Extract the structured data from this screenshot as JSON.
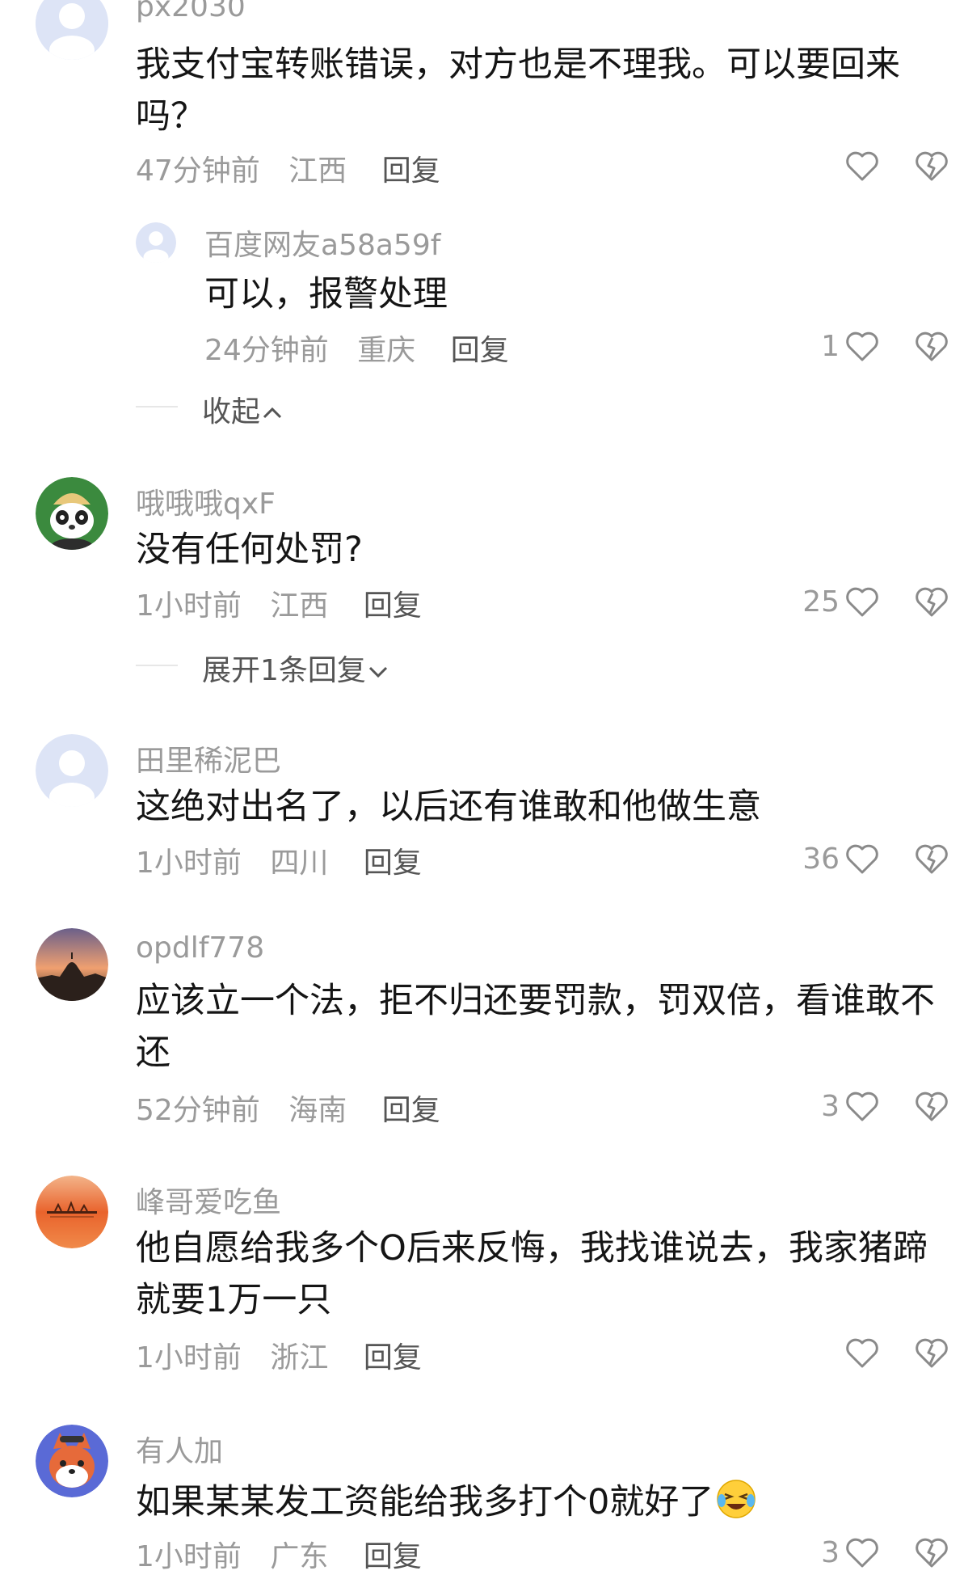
{
  "comments": [
    {
      "username": "px2030",
      "text": "我支付宝转账错误，对方也是不理我。可以要回来吗？",
      "time": "47分钟前",
      "location": "江西",
      "reply_label": "回复",
      "likes": "",
      "avatar": "default-avatar"
    },
    {
      "username": "百度网友a58a59f",
      "text": "可以，报警处理",
      "time": "24分钟前",
      "location": "重庆",
      "reply_label": "回复",
      "likes": "1",
      "avatar": "default-avatar"
    },
    {
      "username": "哦哦哦qxF",
      "text": "没有任何处罚?",
      "time": "1小时前",
      "location": "江西",
      "reply_label": "回复",
      "likes": "25",
      "avatar": "panda-avatar"
    },
    {
      "username": "田里稀泥巴",
      "text": "这绝对出名了，以后还有谁敢和他做生意",
      "time": "1小时前",
      "location": "四川",
      "reply_label": "回复",
      "likes": "36",
      "avatar": "default-avatar"
    },
    {
      "username": "opdlf778",
      "text": "应该立一个法，拒不归还要罚款，罚双倍，看谁敢不还",
      "time": "52分钟前",
      "location": "海南",
      "reply_label": "回复",
      "likes": "3",
      "avatar": "sunset-city-avatar"
    },
    {
      "username": "峰哥爱吃鱼",
      "text": "他自愿给我多个O后来反悔，我找谁说去，我家猪蹄就要1万一只",
      "time": "1小时前",
      "location": "浙江",
      "reply_label": "回复",
      "likes": "",
      "avatar": "sunset-lake-avatar"
    },
    {
      "username": "有人加",
      "text": "如果某某发工资能给我多打个0就好了",
      "time": "1小时前",
      "location": "广东",
      "reply_label": "回复",
      "likes": "3",
      "avatar": "fox-avatar"
    }
  ],
  "collapse_label": "收起",
  "expand_label": "展开1条回复",
  "icons": {
    "like": "heart-outline-icon",
    "dislike": "broken-heart-icon",
    "emoji": "laughing-crying-emoji-icon"
  },
  "colors": {
    "meta_gray": "#9a9a9a",
    "text": "#151515",
    "reply": "#555555",
    "avatar_default": "#dfe6f8"
  }
}
